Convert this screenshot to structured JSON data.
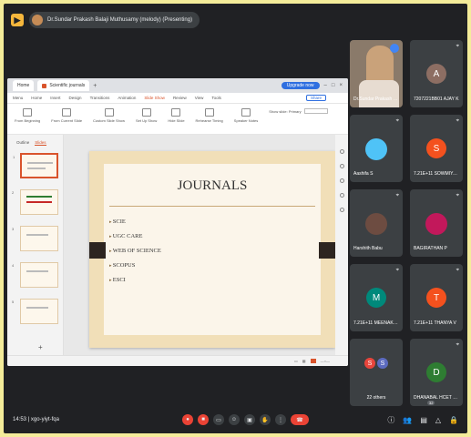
{
  "meeting": {
    "presenting_label": "Dr.Sundar Prakash Balaji Muthusamy (melody) (Presenting)",
    "time": "14:53",
    "separator": "|",
    "code": "xgo-yiyt-fqa"
  },
  "presentation": {
    "browser_tabs": [
      "Home",
      "Scientific journals"
    ],
    "tab_plus": "+",
    "upgrade_label": "Upgrade now",
    "menu_items": [
      "Menu",
      "Home",
      "Insert",
      "Design",
      "Transitions",
      "Animation",
      "Slide Show",
      "Review",
      "View",
      "Tools"
    ],
    "active_menu": "Slide Show",
    "share_label": "Share",
    "ribbon": [
      "From Beginning",
      "From Current Slide",
      "Custom Slide Show",
      "Set Up Show",
      "Hide Slide",
      "Rehearse Timing",
      "Speaker Notes"
    ],
    "ribbon_field": "Show slide: Primary",
    "panel_tabs": [
      "Outline",
      "Slides"
    ],
    "thumb_numbers": [
      "1",
      "2",
      "3",
      "4",
      "5"
    ],
    "add_slide": "+",
    "slide": {
      "title": "JOURNALS",
      "bullets": [
        "SCIE",
        "UGC CARE",
        "WEB OF SCIENCE",
        "SCOPUS",
        "ESCI"
      ]
    }
  },
  "participants": [
    {
      "name": "Dr.Sundar Prakash Bal...",
      "initial": "",
      "color": "#8a7a6a"
    },
    {
      "name": "7207221BB01 AJAY K",
      "initial": "A",
      "color": "#8d6e63"
    },
    {
      "name": "Aashifa S",
      "initial": "",
      "color": "#4fc3f7"
    },
    {
      "name": "7.21E+11 SOWMIYA N",
      "initial": "S",
      "color": "#f4511e"
    },
    {
      "name": "Harshith Babu",
      "initial": "",
      "color": "#6d4c41"
    },
    {
      "name": "BAGIRATHAN P",
      "initial": "",
      "color": "#c2185b"
    },
    {
      "name": "7.21E+11 MEENAKSHI...",
      "initial": "M",
      "color": "#00897b"
    },
    {
      "name": "7.21E+11 THANYA V",
      "initial": "T",
      "color": "#f4511e"
    },
    {
      "name": "22 others",
      "initial": "S",
      "color": "#e8453c"
    },
    {
      "name": "DHANABAL HCET CS...",
      "initial": "D",
      "color": "#2e7d32"
    }
  ],
  "controls": {
    "participant_count": "32",
    "colors": {
      "end": "#ea4335",
      "accent": "#d9542c"
    }
  }
}
